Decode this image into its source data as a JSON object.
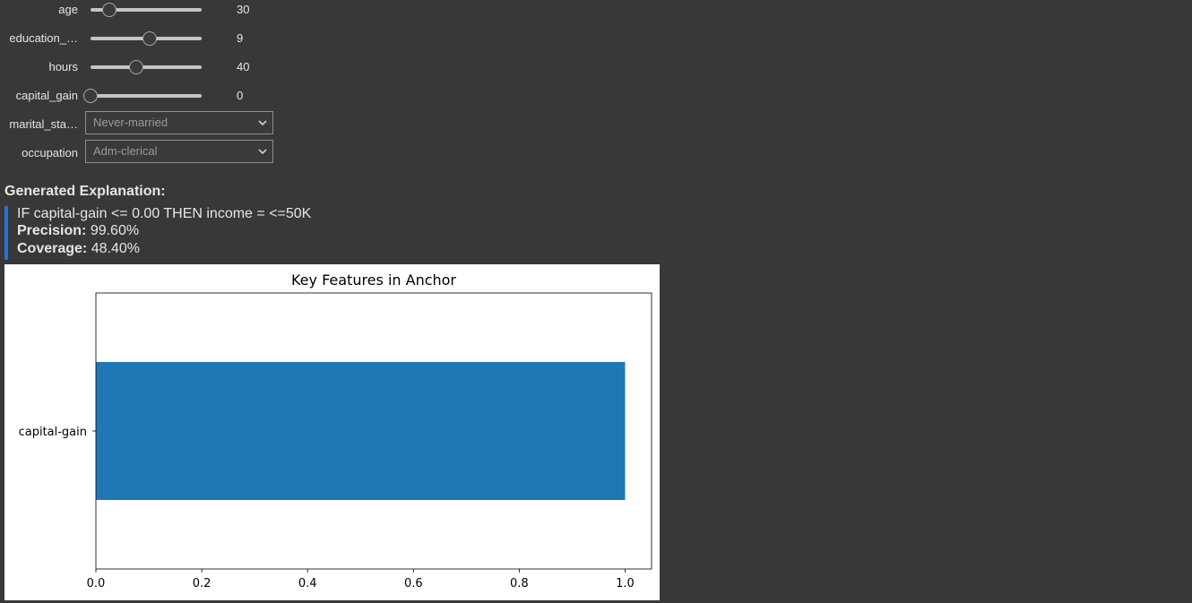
{
  "controls": {
    "sliders": [
      {
        "label": "age",
        "value": "30",
        "fraction": 0.1667
      },
      {
        "label": "education_…",
        "value": "9",
        "fraction": 0.5333
      },
      {
        "label": "hours",
        "value": "40",
        "fraction": 0.4082
      },
      {
        "label": "capital_gain",
        "value": "0",
        "fraction": 0.0
      }
    ],
    "dropdowns": [
      {
        "label": "marital_sta…",
        "selected": "Never-married"
      },
      {
        "label": "occupation",
        "selected": "Adm-clerical"
      }
    ]
  },
  "explanation": {
    "heading": "Generated Explanation:",
    "rule": "IF capital-gain <= 0.00 THEN income = <=50K",
    "precision_label": "Precision:",
    "precision_value": "99.60%",
    "coverage_label": "Coverage:",
    "coverage_value": "48.40%"
  },
  "colors": {
    "accent": "#1e74d8",
    "bar": "#1f77b4",
    "background": "#383838"
  },
  "chart_data": {
    "type": "bar",
    "orientation": "horizontal",
    "title": "Key Features in Anchor",
    "categories": [
      "capital-gain"
    ],
    "values": [
      1.0
    ],
    "xlim": [
      0,
      1.05
    ],
    "xticks": [
      "0.0",
      "0.2",
      "0.4",
      "0.6",
      "0.8",
      "1.0"
    ],
    "xlabel": "",
    "ylabel": "",
    "grid": false
  }
}
